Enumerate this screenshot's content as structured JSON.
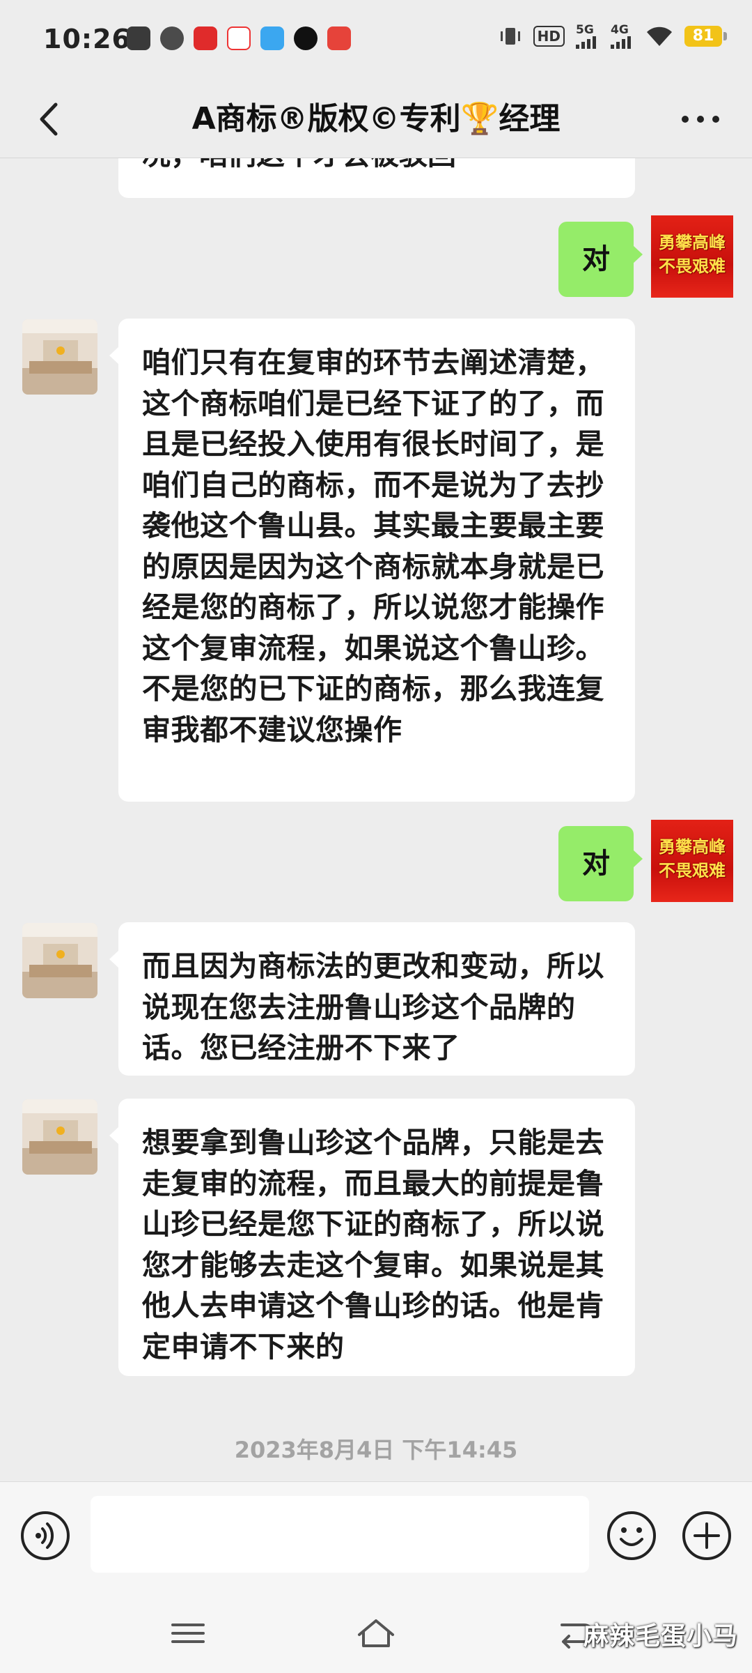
{
  "status_bar": {
    "time": "10:26",
    "network_hd": "HD",
    "network_5g": "5G",
    "network_4g": "4G",
    "battery": "81"
  },
  "header": {
    "title": "A商标®版权©专利🏆经理"
  },
  "partial_message": {
    "text": "况，咱们这个才会被驳回"
  },
  "messages": [
    {
      "side": "right",
      "text": "对"
    },
    {
      "side": "left",
      "text": "咱们只有在复审的环节去阐述清楚，这个商标咱们是已经下证了的了，而且是已经投入使用有很长时间了，是咱们自己的商标，而不是说为了去抄袭他这个鲁山县。其实最主要最主要的原因是因为这个商标就本身就是已经是您的商标了，所以说您才能操作这个复审流程，如果说这个鲁山珍。不是您的已下证的商标，那么我连复审我都不建议您操作"
    },
    {
      "side": "right",
      "text": "对"
    },
    {
      "side": "left",
      "text": "而且因为商标法的更改和变动，所以说现在您去注册鲁山珍这个品牌的话。您已经注册不下来了"
    },
    {
      "side": "left",
      "text": "想要拿到鲁山珍这个品牌，只能是去走复审的流程，而且最大的前提是鲁山珍已经是您下证的商标了，所以说您才能够去走这个复审。如果说是其他人去申请这个鲁山珍的话。他是肯定申请不下来的"
    }
  ],
  "my_avatar": {
    "line1": "勇攀高峰",
    "line2": "不畏艰难"
  },
  "timestamp": "2023年8月4日 下午14:45",
  "input": {
    "value": ""
  },
  "watermark": "麻辣毛蛋小马",
  "colors": {
    "background": "#ededed",
    "sent_bubble": "#95ec69",
    "received_bubble": "#ffffff",
    "timestamp": "#a3a3a3"
  },
  "icons": [
    "back-icon",
    "more-icon",
    "voice-icon",
    "emoji-icon",
    "plus-icon",
    "menu-icon",
    "home-icon",
    "back-nav-icon"
  ]
}
